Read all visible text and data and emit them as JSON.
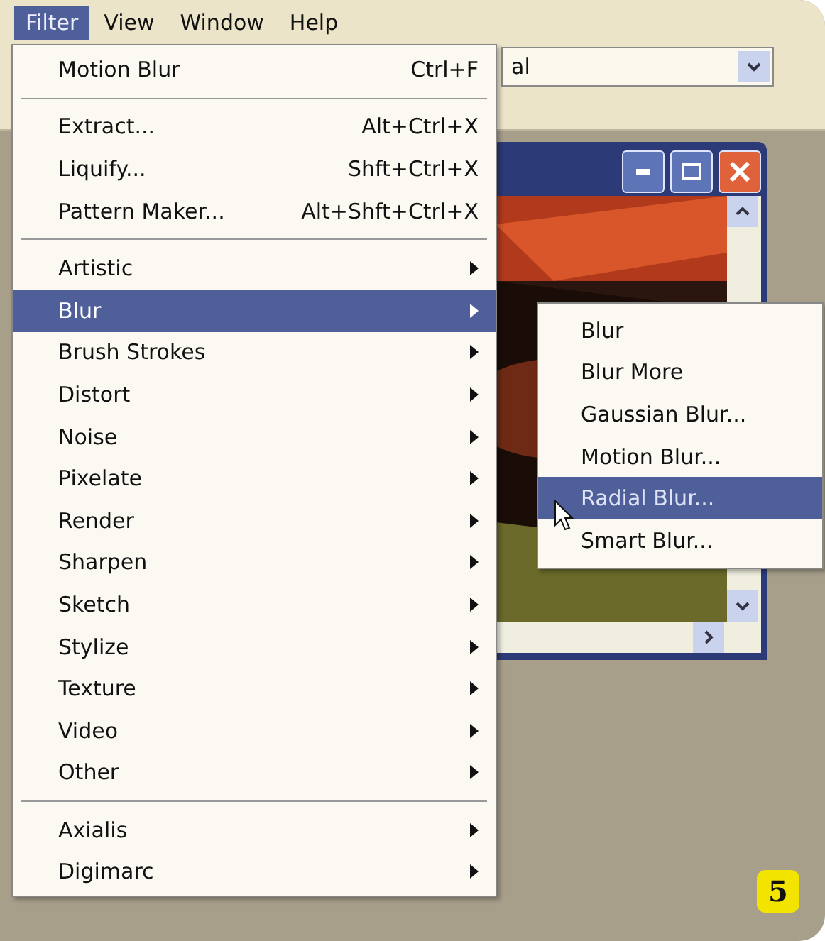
{
  "menu_bar": [
    {
      "label": "Filter",
      "selected": true
    },
    {
      "label": "View",
      "selected": false
    },
    {
      "label": "Window",
      "selected": false
    },
    {
      "label": "Help",
      "selected": false
    }
  ],
  "toolbar": {
    "dropdown_value": "al"
  },
  "filter_menu": {
    "sections": [
      [
        {
          "label": "Motion Blur",
          "shortcut": "Ctrl+F",
          "submenu": false,
          "selected": false
        }
      ],
      [
        {
          "label": "Extract...",
          "shortcut": "Alt+Ctrl+X",
          "submenu": false,
          "selected": false
        },
        {
          "label": "Liquify...",
          "shortcut": "Shft+Ctrl+X",
          "submenu": false,
          "selected": false
        },
        {
          "label": "Pattern Maker...",
          "shortcut": "Alt+Shft+Ctrl+X",
          "submenu": false,
          "selected": false
        }
      ],
      [
        {
          "label": "Artistic",
          "submenu": true,
          "selected": false
        },
        {
          "label": "Blur",
          "submenu": true,
          "selected": true
        },
        {
          "label": "Brush Strokes",
          "submenu": true,
          "selected": false
        },
        {
          "label": "Distort",
          "submenu": true,
          "selected": false
        },
        {
          "label": "Noise",
          "submenu": true,
          "selected": false
        },
        {
          "label": "Pixelate",
          "submenu": true,
          "selected": false
        },
        {
          "label": "Render",
          "submenu": true,
          "selected": false
        },
        {
          "label": "Sharpen",
          "submenu": true,
          "selected": false
        },
        {
          "label": "Sketch",
          "submenu": true,
          "selected": false
        },
        {
          "label": "Stylize",
          "submenu": true,
          "selected": false
        },
        {
          "label": "Texture",
          "submenu": true,
          "selected": false
        },
        {
          "label": "Video",
          "submenu": true,
          "selected": false
        },
        {
          "label": "Other",
          "submenu": true,
          "selected": false
        }
      ],
      [
        {
          "label": "Axialis",
          "submenu": true,
          "selected": false
        },
        {
          "label": "Digimarc",
          "submenu": true,
          "selected": false
        }
      ]
    ]
  },
  "blur_submenu": [
    {
      "label": "Blur",
      "selected": false
    },
    {
      "label": "Blur More",
      "selected": false
    },
    {
      "label": "Gaussian Blur...",
      "selected": false
    },
    {
      "label": "Motion Blur...",
      "selected": false
    },
    {
      "label": "Radial Blur...",
      "selected": true
    },
    {
      "label": "Smart Blur...",
      "selected": false
    }
  ],
  "step_badge": "5"
}
